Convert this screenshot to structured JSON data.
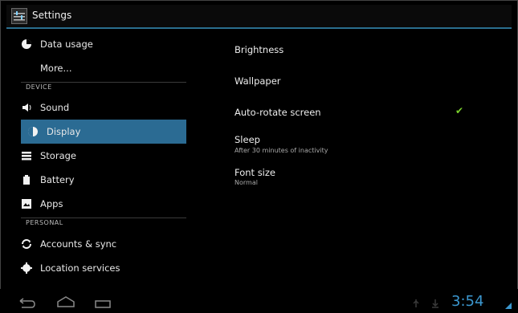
{
  "action_bar": {
    "title": "Settings"
  },
  "left_list": {
    "items": [
      {
        "label": "Data usage",
        "icon": "data-usage-icon"
      },
      {
        "label": "More...",
        "icon": ""
      },
      {
        "label": "Sound",
        "icon": "speaker-icon"
      },
      {
        "label": "Display",
        "icon": "display-icon",
        "selected": true
      },
      {
        "label": "Storage",
        "icon": "storage-icon"
      },
      {
        "label": "Battery",
        "icon": "battery-icon"
      },
      {
        "label": "Apps",
        "icon": "apps-icon"
      },
      {
        "label": "Accounts & sync",
        "icon": "sync-icon"
      },
      {
        "label": "Location services",
        "icon": "location-icon"
      }
    ],
    "sections": [
      {
        "label": "DEVICE"
      },
      {
        "label": "PERSONAL"
      }
    ]
  },
  "display_settings": {
    "items": [
      {
        "label": "Brightness"
      },
      {
        "label": "Wallpaper"
      },
      {
        "label": "Auto-rotate screen",
        "checked": true
      },
      {
        "label": "Sleep",
        "summary": "After 30 minutes of inactivity"
      },
      {
        "label": "Font size",
        "summary": "Normal"
      }
    ]
  },
  "system_bar": {
    "time": "3:54"
  },
  "colors": {
    "accent": "#2b6b93",
    "check": "#7bd22d",
    "clock": "#3b97cf"
  }
}
